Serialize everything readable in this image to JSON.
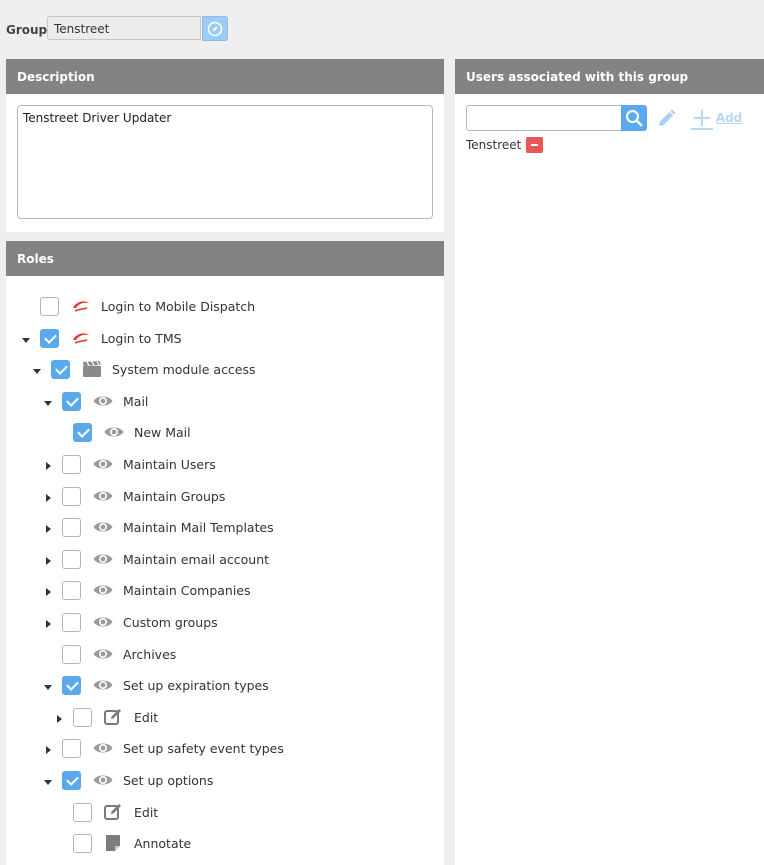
{
  "group": {
    "label": "Group",
    "value": "Tenstreet"
  },
  "description": {
    "header": "Description",
    "text": "Tenstreet Driver Updater"
  },
  "users": {
    "header": "Users associated with this group",
    "search_placeholder": "",
    "add_label": "Add",
    "items": [
      {
        "name": "Tenstreet"
      }
    ]
  },
  "roles": {
    "header": "Roles",
    "items": [
      {
        "label": "Login to Mobile Dispatch",
        "checked": false,
        "icon": "mobile-dispatch-icon",
        "expander": "none"
      },
      {
        "label": "Login to TMS",
        "checked": true,
        "icon": "tms-icon",
        "expander": "expanded"
      },
      {
        "label": "System module access",
        "checked": true,
        "icon": "clapperboard-icon",
        "expander": "expanded"
      },
      {
        "label": "Mail",
        "checked": true,
        "icon": "eye-icon",
        "expander": "expanded"
      },
      {
        "label": "New Mail",
        "checked": true,
        "icon": "eye-icon",
        "expander": "none"
      },
      {
        "label": "Maintain Users",
        "checked": false,
        "icon": "eye-icon",
        "expander": "collapsed"
      },
      {
        "label": "Maintain Groups",
        "checked": false,
        "icon": "eye-icon",
        "expander": "collapsed"
      },
      {
        "label": "Maintain Mail Templates",
        "checked": false,
        "icon": "eye-icon",
        "expander": "collapsed"
      },
      {
        "label": "Maintain email account",
        "checked": false,
        "icon": "eye-icon",
        "expander": "collapsed"
      },
      {
        "label": "Maintain Companies",
        "checked": false,
        "icon": "eye-icon",
        "expander": "collapsed"
      },
      {
        "label": "Custom groups",
        "checked": false,
        "icon": "eye-icon",
        "expander": "collapsed"
      },
      {
        "label": "Archives",
        "checked": false,
        "icon": "eye-icon",
        "expander": "none"
      },
      {
        "label": "Set up expiration types",
        "checked": true,
        "icon": "eye-icon",
        "expander": "expanded"
      },
      {
        "label": "Edit",
        "checked": false,
        "icon": "edit-icon",
        "expander": "collapsed"
      },
      {
        "label": "Set up safety event types",
        "checked": false,
        "icon": "eye-icon",
        "expander": "collapsed"
      },
      {
        "label": "Set up options",
        "checked": true,
        "icon": "eye-icon",
        "expander": "expanded"
      },
      {
        "label": "Edit",
        "checked": false,
        "icon": "edit-icon",
        "expander": "none"
      },
      {
        "label": "Annotate",
        "checked": false,
        "icon": "annotate-icon",
        "expander": "none"
      }
    ]
  },
  "colors": {
    "header_bg": "#818385",
    "accent": "#59a9ec",
    "remove": "#e9575a"
  }
}
